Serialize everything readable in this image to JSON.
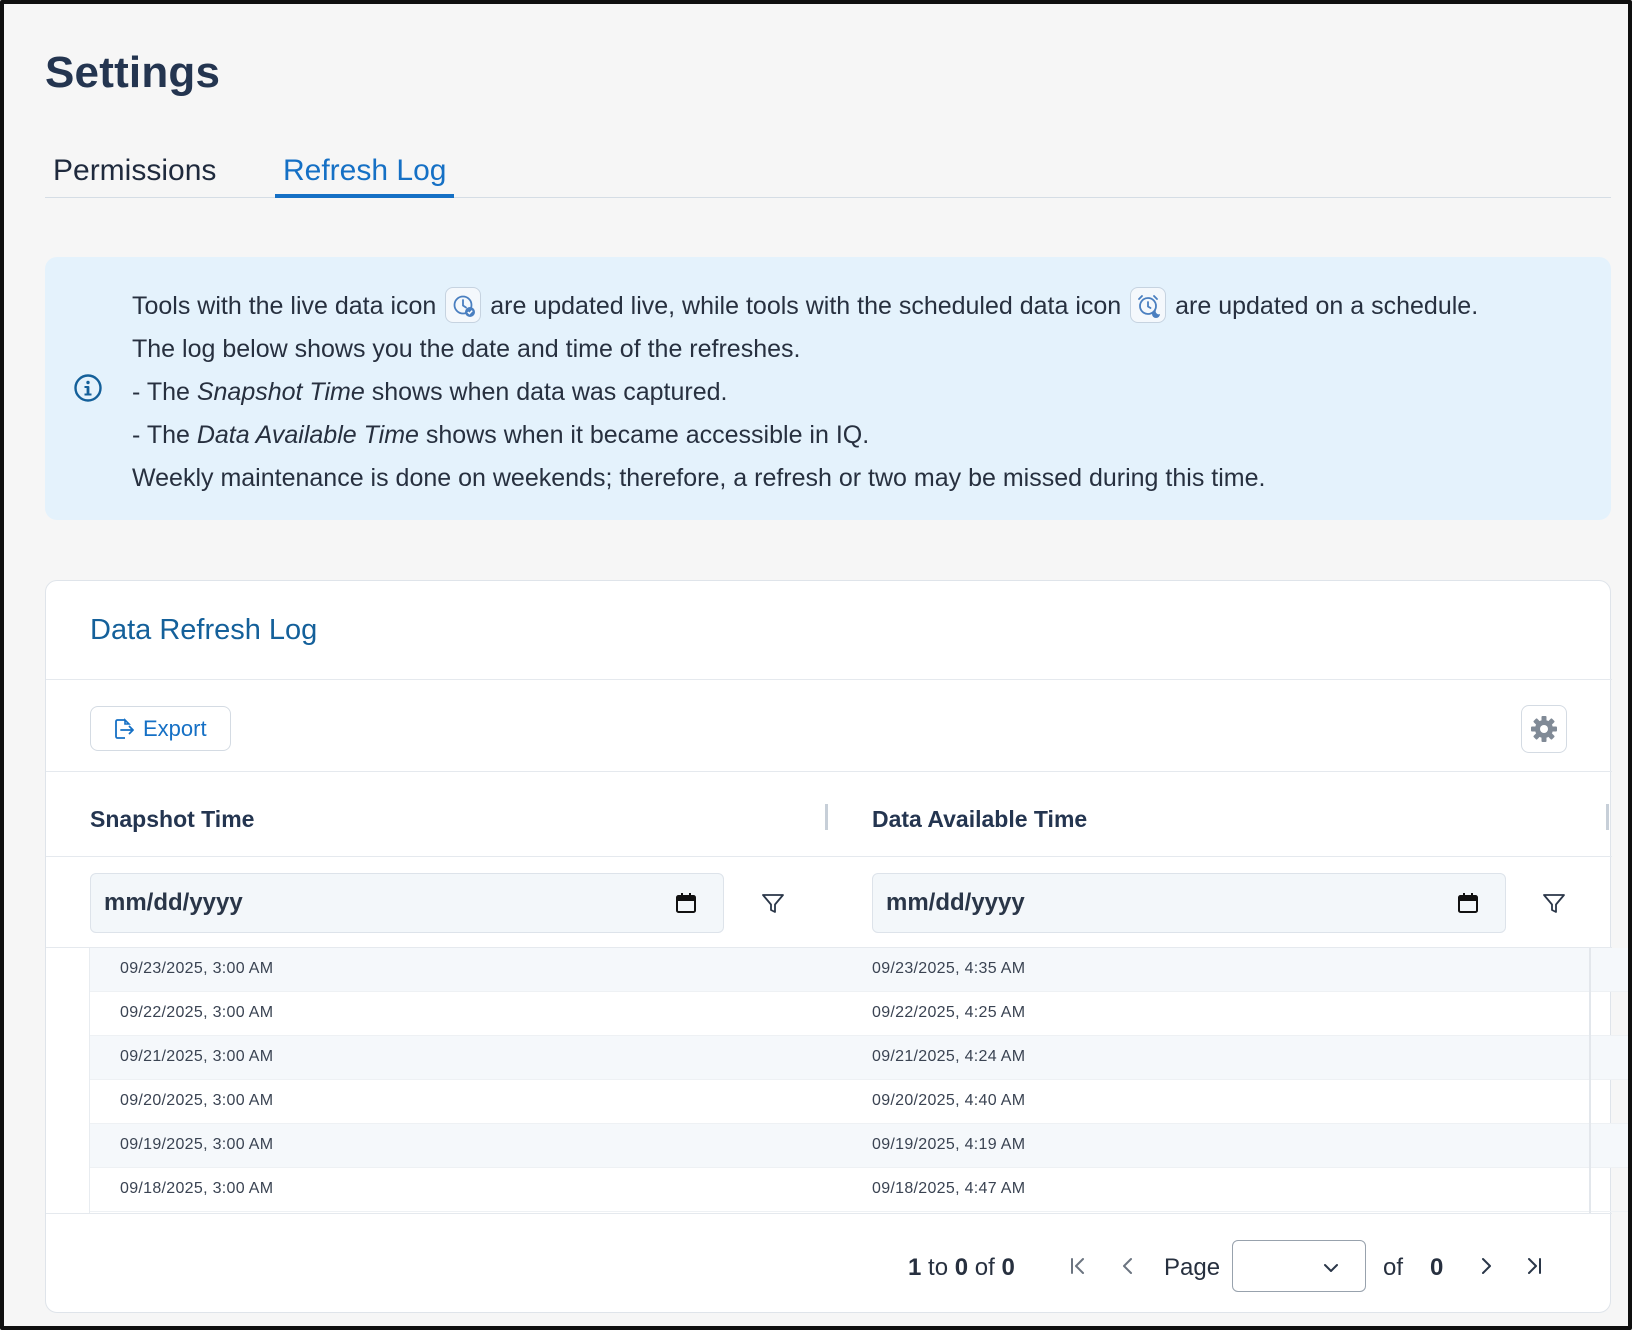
{
  "page": {
    "title": "Settings"
  },
  "tabs": [
    {
      "label": "Permissions",
      "active": false
    },
    {
      "label": "Refresh Log",
      "active": true
    }
  ],
  "info": {
    "line1_a": "Tools with the live data icon",
    "line1_b": "are updated live, while tools with the scheduled data icon",
    "line1_c": "are updated on a schedule.",
    "line2": "The log below shows you the date and time of the refreshes.",
    "line3_prefix": "- The ",
    "line3_em": "Snapshot Time",
    "line3_suffix": " shows when data was captured.",
    "line4_prefix": "- The ",
    "line4_em": "Data Available Time",
    "line4_suffix": " shows when it became accessible in IQ.",
    "line5": "Weekly maintenance is done on weekends; therefore, a refresh or two may be missed during this time.",
    "live_icon": "clock-check-icon",
    "scheduled_icon": "alarm-clock-icon"
  },
  "card": {
    "title": "Data Refresh Log",
    "export_label": "Export",
    "columns": [
      "Snapshot Time",
      "Data Available Time"
    ],
    "date_placeholder": "mm/dd/yyyy",
    "rows": [
      [
        "09/23/2025, 3:00 AM",
        "09/23/2025, 4:35 AM"
      ],
      [
        "09/22/2025, 3:00 AM",
        "09/22/2025, 4:25 AM"
      ],
      [
        "09/21/2025, 3:00 AM",
        "09/21/2025, 4:24 AM"
      ],
      [
        "09/20/2025, 3:00 AM",
        "09/20/2025, 4:40 AM"
      ],
      [
        "09/19/2025, 3:00 AM",
        "09/19/2025, 4:19 AM"
      ],
      [
        "09/18/2025, 3:00 AM",
        "09/18/2025, 4:47 AM"
      ]
    ]
  },
  "pager": {
    "from": "1",
    "to_word": "to",
    "to": "0",
    "of_word": "of",
    "total": "0",
    "page_label": "Page",
    "page_value": "",
    "of_label": "of",
    "page_total": "0"
  },
  "colors": {
    "accent": "#1570c5",
    "card_title": "#14609a",
    "info_bg": "#e4f2fc",
    "heading": "#243550"
  }
}
